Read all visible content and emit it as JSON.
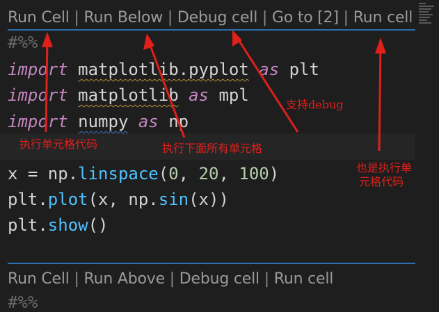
{
  "codelens_top": {
    "run_cell": "Run Cell",
    "run_below": "Run Below",
    "debug_cell": "Debug cell",
    "goto": "Go to [2]",
    "run_cell_2": "Run cell",
    "separator": "|"
  },
  "code": {
    "cell_marker": "#%%",
    "import_kw": "import",
    "as_kw": "as",
    "mod_pyplot": "matplotlib.pyplot",
    "alias_plt": "plt",
    "mod_mpl": "matplotlib",
    "alias_mpl": "mpl",
    "mod_numpy": "numpy",
    "alias_np": "np",
    "line_x_var": "x = np.",
    "line_x_fn": "linspace",
    "line_x_open": "(",
    "line_x_n1": "0",
    "line_x_n2": "20",
    "line_x_n3": "100",
    "line_x_comma": ", ",
    "line_x_close": ")",
    "line_plot_pre": "plt.",
    "line_plot_fn": "plot",
    "line_plot_mid": "(x, np.",
    "line_plot_sin": "sin",
    "line_plot_end": "(x))",
    "line_show_pre": "plt.",
    "line_show_fn": "show",
    "line_show_end": "()"
  },
  "codelens_bottom": {
    "run_cell": "Run Cell",
    "run_above": "Run Above",
    "debug_cell": "Debug cell",
    "run_cell_2": "Run cell",
    "separator": "|"
  },
  "annotations": {
    "run_cell_code": "执行单元格代码",
    "run_below_all": "执行下面所有单元格",
    "support_debug": "支持debug",
    "also_run_line1": "也是执行单",
    "also_run_line2": "元格代码"
  },
  "colors": {
    "annotation": "#e0201a",
    "cell_border": "#2a6fb0",
    "keyword": "#c586c0",
    "function": "#4fc1ff",
    "number": "#b5cea8"
  }
}
